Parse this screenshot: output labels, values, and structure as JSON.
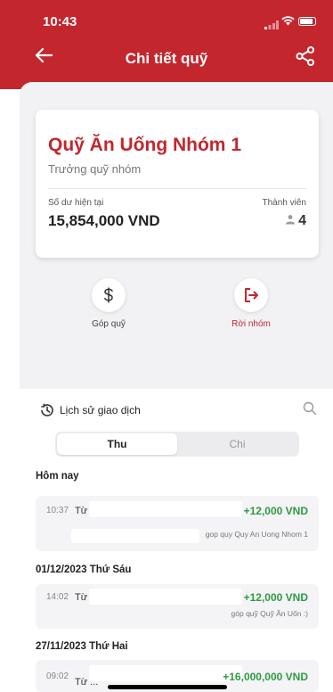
{
  "status_bar": {
    "time": "10:43"
  },
  "header": {
    "title": "Chi tiết quỹ"
  },
  "fund": {
    "name": "Quỹ Ăn Uống Nhóm 1",
    "role": "Trưởng quỹ nhóm",
    "balance_label": "Số dư hiện tại",
    "balance_value": "15,854,000 VND",
    "members_label": "Thành viên",
    "members_count": "4"
  },
  "actions": {
    "contribute_label": "Góp quỹ",
    "leave_label": "Rời nhóm"
  },
  "history": {
    "title": "Lịch sử giao dịch",
    "tabs": [
      "Thu",
      "Chi"
    ],
    "groups": [
      {
        "date": "Hôm nay",
        "items": [
          {
            "time": "10:37",
            "from": "Từ",
            "amount": "+12,000 VND",
            "note": "gop quy Quy An Uong Nhom 1"
          }
        ]
      },
      {
        "date": "01/12/2023 Thứ Sáu",
        "items": [
          {
            "time": "14:02",
            "from": "Từ",
            "amount": "+12,000 VND",
            "note": "góp quỹ Quỹ Ăn Uốn :)"
          }
        ]
      },
      {
        "date": "27/11/2023 Thứ Hai",
        "items": [
          {
            "time": "09:02",
            "from": "Từ ...",
            "amount": "+16,000,000 VND",
            "note": ""
          }
        ]
      }
    ]
  },
  "colors": {
    "brand": "#c4262e",
    "positive": "#2d9a43",
    "background_gray": "#f2f2f4"
  }
}
